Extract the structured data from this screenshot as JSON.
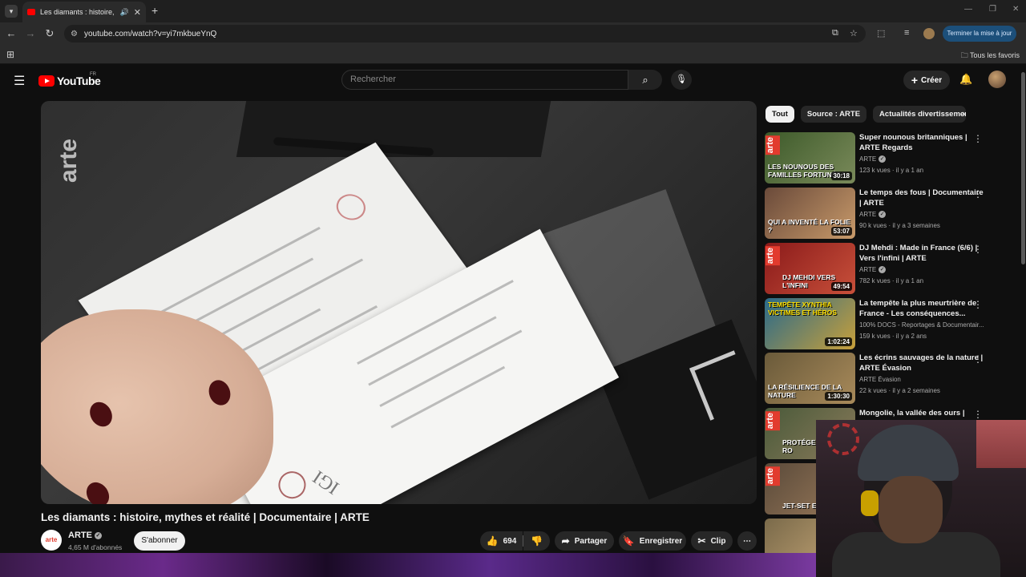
{
  "browser": {
    "tab_title": "Les diamants : histoire, mythes et réalité | Documentaire | ARTE",
    "url": "youtube.com/watch?v=yi7mkbueYnQ",
    "update_button": "Terminer la mise à jour",
    "bookmarks_all": "Tous les favoris"
  },
  "youtube": {
    "logo_text": "YouTube",
    "country_code": "FR",
    "search_placeholder": "Rechercher",
    "create_label": "Créer"
  },
  "video": {
    "watermark": "arte",
    "title": "Les diamants : histoire, mythes et réalité | Documentaire | ARTE",
    "channel_logo": "arte",
    "channel": "ARTE",
    "subscribers": "4,65 M d'abonnés",
    "subscribe_label": "S'abonner",
    "likes": "694",
    "share_label": "Partager",
    "save_label": "Enregistrer",
    "clip_label": "Clip"
  },
  "chips": [
    "Tout",
    "Source : ARTE",
    "Actualités divertissement"
  ],
  "recommendations": [
    {
      "title": "Super nounous britanniques | ARTE Regards",
      "channel": "ARTE",
      "verified": true,
      "stats": "123 k vues · il y a 1 an",
      "duration": "30:18",
      "thumb_text": "LES NOUNOUS DES FAMILLES FORTUNÉES",
      "color": "#3d5a2a"
    },
    {
      "title": "Le temps des fous | Documentaire | ARTE",
      "channel": "ARTE",
      "verified": true,
      "stats": "90 k vues · il y a 3 semaines",
      "duration": "53:07",
      "thumb_text": "QUI A INVENTÉ LA FOLIE ?",
      "color": "#6a4a3a"
    },
    {
      "title": "DJ Mehdi : Made in France (6/6) | Vers l'infini | ARTE",
      "channel": "ARTE",
      "verified": true,
      "stats": "782 k vues · il y a 1 an",
      "duration": "49:54",
      "thumb_text": "DJ MEHDI VERS L'INFINI",
      "color": "#8a1a1a"
    },
    {
      "title": "La tempête la plus meurtrière de France - Les conséquences...",
      "channel": "100% DOCS - Reportages & Documentair...",
      "verified": false,
      "stats": "159 k vues · il y a 2 ans",
      "duration": "1:02:24",
      "thumb_text": "TEMPÊTE XYNTHIA VICTIMES ET HÉROS",
      "color": "#2a6a8a"
    },
    {
      "title": "Les écrins sauvages de la nature | ARTE Évasion",
      "channel": "ARTE Évasion",
      "verified": false,
      "stats": "22 k vues · il y a 2 semaines",
      "duration": "1:30:30",
      "thumb_text": "LA RÉSILIENCE DE LA NATURE",
      "color": "#6a5a3a"
    },
    {
      "title": "Mongolie, la vallée des ours |",
      "channel": "",
      "verified": false,
      "stats": "",
      "duration": "",
      "thumb_text": "PROTÉGER LA TAÏGA RO",
      "color": "#4a5a3a"
    },
    {
      "title": "",
      "channel": "",
      "verified": false,
      "stats": "",
      "duration": "",
      "thumb_text": "JET-SET ET PORNO",
      "color": "#5a4a3a"
    },
    {
      "title": "",
      "channel": "",
      "verified": false,
      "stats": "",
      "duration": "",
      "thumb_text": "",
      "color": "#7a6a4a"
    }
  ]
}
